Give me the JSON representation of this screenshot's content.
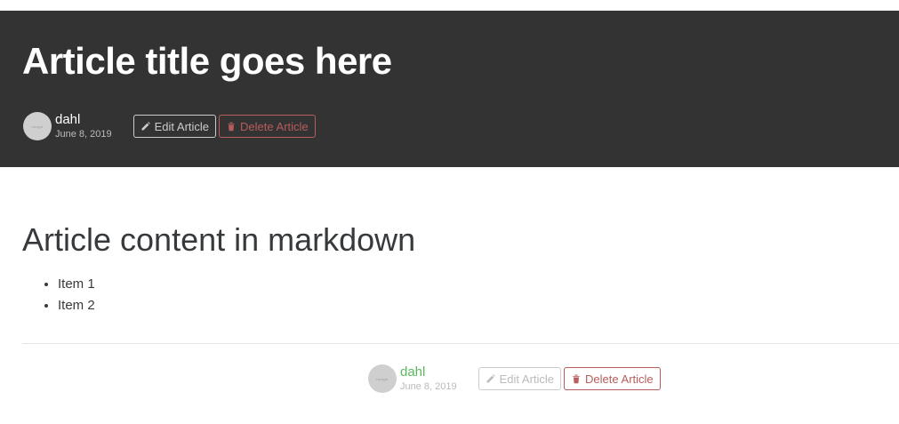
{
  "banner": {
    "title": "Article title goes here",
    "author": "dahl",
    "date": "June 8, 2019",
    "edit_label": "Edit Article",
    "delete_label": "Delete Article",
    "avatar_text": "image"
  },
  "content": {
    "heading": "Article content in markdown",
    "items": [
      "Item 1",
      "Item 2"
    ]
  },
  "footer": {
    "author": "dahl",
    "date": "June 8, 2019",
    "edit_label": "Edit Article",
    "delete_label": "Delete Article",
    "avatar_text": "image"
  },
  "colors": {
    "banner_bg": "#333333",
    "author_link": "#5cb85c",
    "danger": "#b85c5c"
  }
}
